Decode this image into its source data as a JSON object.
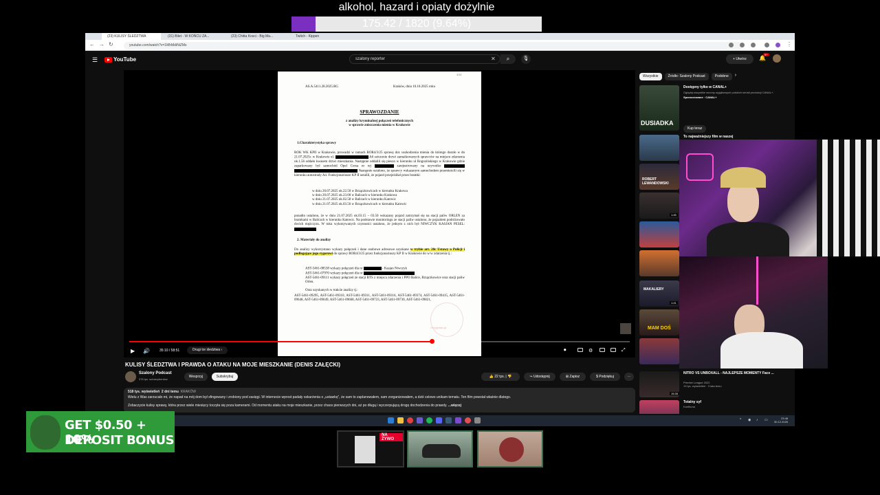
{
  "overlay": {
    "title": "alkohol, hazard i opiaty dożylnie",
    "progress_text": "175.42 / 1820 (9.64%)",
    "progress_fraction": 0.0964
  },
  "browser": {
    "tabs": [
      "(23) KULISY ŚLEDZTWA",
      "(31) Bilet - W KOŃCU ZA...",
      "(23) Chitta Kosci - Big Ma...",
      "Twitch - Kippen"
    ],
    "url": "youtube.com/watch?v=1MhMdiNiZMs"
  },
  "youtube": {
    "logo": "YouTube",
    "search_value": "szalony reporter",
    "create_label": "Utwórz",
    "bell_count": "9+"
  },
  "document": {
    "ref": "AS.A.5411.28.2025.RG",
    "place_date": "Kraków, dnia   10.10.2025 roku",
    "title": "SPRAWOZDANIE",
    "subtitle_1": "z analizy kryminalnej połączeń telefonicznych",
    "subtitle_2": "w sprawie zniszczenia mienia w Krakowie",
    "section_1": "1.Charakterystyka sprawy",
    "p1": "ROK WK KPII w Krakowie, prowadzi w ramach ROR4/3/25 sprawę dot. uszkodzenia mienia do którego doszło w dn 21.07.2025r. w Krakowie ul.",
    "p1b": "A6 sztucznie drzwi zamaikowanych sprawców na miejscu zdarzenia ok.1.56 oddało kwasem drzwi mieszkania. Następnie oddalili się pieszo w kierunku ul Rogozińskiego w Krakowie gdzie zaparkowany był samochód Opel Corsa nr rej",
    "p1c": "zarejestrowany na uzywniko",
    "p2": "Następnie ustalono, że sprawcy wskazanym samochodem przemieścili się w kierunku autostrady A4. Funkcjonariusze KP II ustalili, że pojazd przejeżdżał przez bramki:",
    "list": [
      "w dniu 20.07.2025 ok.22.50 w Brzączkowicach w kierunku Krakowa",
      "w dniu 20.07.2025 ok.23.00 w Balicach w kierunku Krakowa",
      "w dniu 21.07.2025 ok.02.58 w Balicach w kierunku Katowic",
      "w dniu 21.07.2025 ok.03.56 w Brzączkowicach w kierunku Katowic"
    ],
    "p3": "ponadto ustalono, że w dniu 21.07.2025 ok.03.15 – 03.50 wskazany pojazd zatrzymał się na stacji paliw ORLEN za bramkami w Balicach w kierunku Katowic. Na podstawie monitoringu ze stacji paliw ustalono, że pojazdem podróżowało dwóch mężczyzn. W toku wykonywanych czynności ustalono, że jednym z nich był NIWCZYK KASJAN PESEL:",
    "section_2": "2. Materiały do analizy",
    "p4a": "Do analizy wykorzystano wykazy połączeń i dane osobowe adresowe uzyskane",
    "p4_highlight": "w trybie art. 20c Ustawy o Policji i podlegające jego rygorowi",
    "p4b": "do sprawy ROR4/3/25 przez funkcjonariuszy KP II w Krakowie do w/w zdarzenia tj.:",
    "ast1": "AST-5461-08538 wykazy połączeń dla nr",
    "ast1b": "- Kasjan Niwczyk",
    "ast2": "AST-5461-07970 wykazy połączeń dla nr",
    "ast3": "AST-5461-09111 wykazy połączeń ze stacji BTS z miejsca zdarzenia i PPO Balice, Brzączkowice oraz stacji paliw Orlen.",
    "p5": "Oraz uzyskanych w trakcie analizy tj.:",
    "p6": "AST-5461-09295, AST-5461-09310, AST-5461-09311, AST-5461-09316, AST-5461-09374, AST-5461-09415, AST-5461-09648, AST-5461-09649, AST-5461-09668, AST-5461-09723, AST-5461-09730, AST-5461-09821,",
    "page_no": "4/24",
    "watermark": "e-szygomec.pl"
  },
  "player": {
    "time": "35:10 / 58:51",
    "chapter": "Drugi tor śledztwa",
    "progress_fraction": 0.604
  },
  "video": {
    "title": "KULISY ŚLEDZTWA I PRAWDA O ATAKU NA MOJE MIESZKANIE (DENIS ZAŁĘCKI)",
    "channel": "Szalony Podcast",
    "subscribers": "376 tys. subskrybentów",
    "support_label": "Wesprzyj",
    "subscribe_label": "Subskrybuj",
    "likes": "22 tys.",
    "share_label": "Udostępnij",
    "save_label": "Zapisz",
    "thanks_label": "Podziękuj",
    "views": "518 tys. wyświetleń",
    "age": "2 dni temu",
    "location": "KRAKÓW",
    "desc_1": "Wielu z Was zarzucało mi, że napad na mój dom był sfingowany i zrobiony pod zasięgi. W internecie wprost padały oskarżenia o „ustawkę”, że sam to zaplanowałem, sam zorganizowałem, a dziś celowo unikam tematu. Ten film powstał właśnie dlatego.",
    "desc_2": "Zobaczycie kulisy sprawy, która przez wiele miesięcy toczyła się poza kamerami. Od momentu ataku na moje mieszkanie, przez chaos pierwszych dni, aż po długą i wyczerpującą drogę dochodzenia do prawdy.",
    "more_label": "...więcej"
  },
  "sidebar": {
    "chips": [
      "Wszystkie",
      "Źródło: Szalony Podcast",
      "Podobne"
    ],
    "items": [
      {
        "title": "Dostępny tylko w CANAL+",
        "meta": "Oglądaj wszystkie sezony wyjątkowych polskich seriali produkcji CANAL+.",
        "meta2": "Sponsorowane · CANAL+",
        "thumb_text": "DUSIADKA",
        "duration": ""
      },
      {
        "title": "To najważniejszy film w naszej",
        "meta": "",
        "meta2": "",
        "thumb_text": "",
        "duration": ""
      },
      {
        "title": "",
        "meta": "",
        "meta2": "",
        "thumb_text": "ROBERT LEWANDOWSKI",
        "duration": ""
      },
      {
        "title": "",
        "meta": "",
        "meta2": "",
        "thumb_text": "",
        "duration": "1:45"
      },
      {
        "title": "",
        "meta": "",
        "meta2": "",
        "thumb_text": "",
        "duration": ""
      },
      {
        "title": "",
        "meta": "",
        "meta2": "",
        "thumb_text": "",
        "duration": ""
      },
      {
        "title": "",
        "meta": "",
        "meta2": "",
        "thumb_text": "MAKALIERY",
        "duration": "1:41"
      },
      {
        "title": "",
        "meta": "",
        "meta2": "",
        "thumb_text": "MAM DOŚ",
        "duration": ""
      },
      {
        "title": "",
        "meta": "",
        "meta2": "",
        "thumb_text": "",
        "duration": ""
      },
      {
        "title": "NITRO VS UNBOXALL - NAJLEPSZE MOMENTY Face ...",
        "meta": "Premier League 2022",
        "meta2": "13 tys. wyświetleń · 3 lata temu",
        "thumb_text": "",
        "duration": "15:35"
      },
      {
        "title": "Totalny syf",
        "meta": "Kanfkuna",
        "meta2": "",
        "thumb_text": "",
        "duration": ""
      }
    ],
    "buy_label": "Kup teraz"
  },
  "taskbar": {
    "time": "23:48",
    "date": "30.12.2025"
  },
  "ad": {
    "line1": "GET $0.50 + 10%",
    "line2": "DEPOSIT BONUS"
  },
  "bottom": {
    "live_label": "NA ŻYWO"
  },
  "colors": {
    "overlay_fill": "#7a2fc0",
    "yt_red": "#ff0000",
    "highlight": "#f5f04a",
    "ad_green": "#2f9a3a"
  }
}
